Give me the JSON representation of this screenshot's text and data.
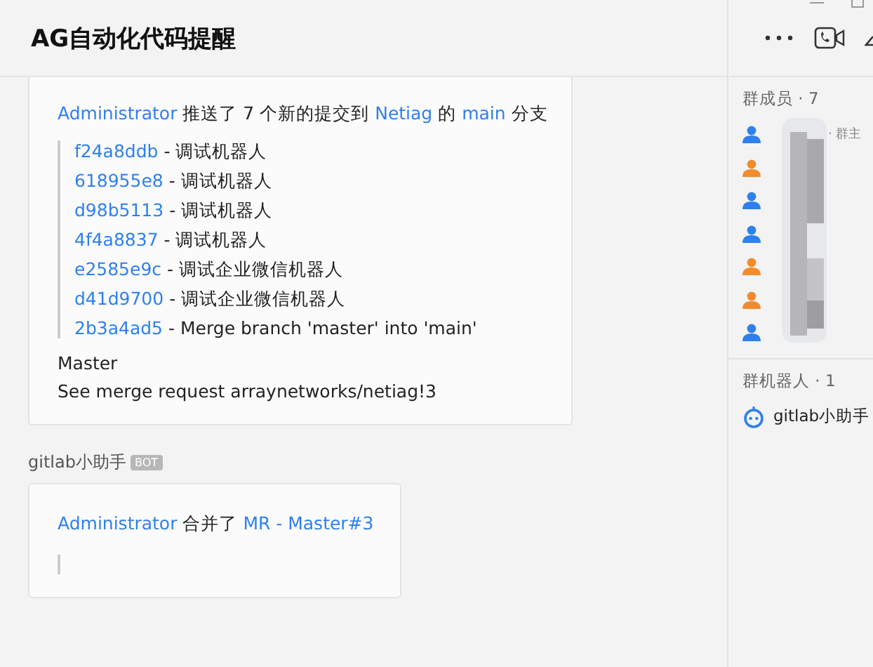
{
  "window": {
    "title": "AG自动化代码提醒"
  },
  "messages": [
    {
      "kind": "push",
      "actor": "Administrator",
      "verb": "推送了 7 个新的提交到",
      "project": "Netiag",
      "of": "的",
      "branch": "main",
      "suffix": "分支",
      "commits": [
        {
          "hash": "f24a8ddb",
          "message": "- 调试机器人"
        },
        {
          "hash": "618955e8",
          "message": "- 调试机器人"
        },
        {
          "hash": "d98b5113",
          "message": "- 调试机器人"
        },
        {
          "hash": "4f4a8837",
          "message": "- 调试机器人"
        },
        {
          "hash": "e2585e9c",
          "message": "- 调试企业微信机器人"
        },
        {
          "hash": "d41d9700",
          "message": "- 调试企业微信机器人"
        },
        {
          "hash": "2b3a4ad5",
          "message": "- Merge branch 'master' into 'main'"
        }
      ],
      "footer": [
        "Master",
        "See merge request arraynetworks/netiag!3"
      ]
    },
    {
      "kind": "merge",
      "sender": {
        "name": "gitlab小助手",
        "badge": "BOT"
      },
      "actor": "Administrator",
      "verb": "合并了",
      "link": "MR - Master#3"
    }
  ],
  "sidebar": {
    "members_heading": "群成员 · 7",
    "members": [
      {
        "color": "#2f80ed",
        "role": "· 群主"
      },
      {
        "color": "#f08c2e"
      },
      {
        "color": "#2f80ed"
      },
      {
        "color": "#2f80ed"
      },
      {
        "color": "#f08c2e"
      },
      {
        "color": "#f08c2e"
      },
      {
        "color": "#2f80ed"
      }
    ],
    "bots_heading": "群机器人 · 1",
    "bots": [
      {
        "name": "gitlab小助手"
      }
    ]
  }
}
